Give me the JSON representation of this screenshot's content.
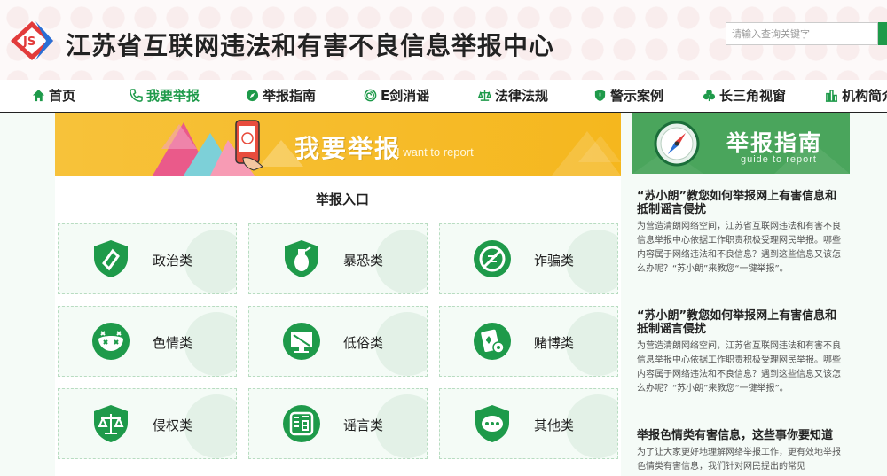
{
  "header": {
    "site_title": "江苏省互联网违法和有害不良信息举报中心",
    "logo_text": "JS",
    "search_placeholder": "请输入查询关键字"
  },
  "nav": {
    "items": [
      {
        "label": "首页",
        "icon": "home-icon",
        "active": false
      },
      {
        "label": "我要举报",
        "icon": "phone-icon",
        "active": true
      },
      {
        "label": "举报指南",
        "icon": "compass-icon",
        "active": false
      },
      {
        "label": "E剑消谣",
        "icon": "swirl-icon",
        "active": false
      },
      {
        "label": "法律法规",
        "icon": "scales-icon",
        "active": false
      },
      {
        "label": "警示案例",
        "icon": "shield-icon",
        "active": false
      },
      {
        "label": "长三角视窗",
        "icon": "clover-icon",
        "active": false
      },
      {
        "label": "机构简介",
        "icon": "building-icon",
        "active": false
      }
    ]
  },
  "report_banner": {
    "title": "我要举报",
    "subtitle": "I want to report"
  },
  "report_section": {
    "title": "举报入口",
    "categories": [
      {
        "label": "政治类",
        "icon": "shield-icon"
      },
      {
        "label": "暴恐类",
        "icon": "grenade-icon"
      },
      {
        "label": "诈骗类",
        "icon": "no-fraud-icon"
      },
      {
        "label": "色情类",
        "icon": "mask-icon"
      },
      {
        "label": "低俗类",
        "icon": "vulgar-screen-icon"
      },
      {
        "label": "赌博类",
        "icon": "gambling-card-icon"
      },
      {
        "label": "侵权类",
        "icon": "scales-icon"
      },
      {
        "label": "谣言类",
        "icon": "rumor-icon"
      },
      {
        "label": "其他类",
        "icon": "chat-bubble-icon"
      }
    ]
  },
  "guide_banner": {
    "title": "举报指南",
    "subtitle": "guide to report"
  },
  "articles": [
    {
      "title": "“苏小朗”教您如何举报网上有害信息和抵制谣言侵扰",
      "body": "为营造清朗网络空间，江苏省互联网违法和有害不良信息举报中心依据工作职责积极受理网民举报。哪些内容属于网络违法和不良信息？遇到这些信息又该怎么办呢？“苏小朗”来教您“一键举报”。"
    },
    {
      "title": "“苏小朗”教您如何举报网上有害信息和抵制谣言侵扰",
      "body": "为营造清朗网络空间，江苏省互联网违法和有害不良信息举报中心依据工作职责积极受理网民举报。哪些内容属于网络违法和不良信息？遇到这些信息又该怎么办呢？“苏小朗”来教您“一键举报”。"
    },
    {
      "title": "举报色情类有害信息，这些事你要知道",
      "body": "为了让大家更好地理解网络举报工作，更有效地举报色情类有害信息，我们针对网民提出的常见"
    }
  ],
  "colors": {
    "brand_green": "#1e9a4a",
    "banner_yellow": "#f5b71e",
    "guide_green": "#4aa55c",
    "logo_red": "#e23b3b",
    "logo_blue": "#2a6fd6"
  }
}
